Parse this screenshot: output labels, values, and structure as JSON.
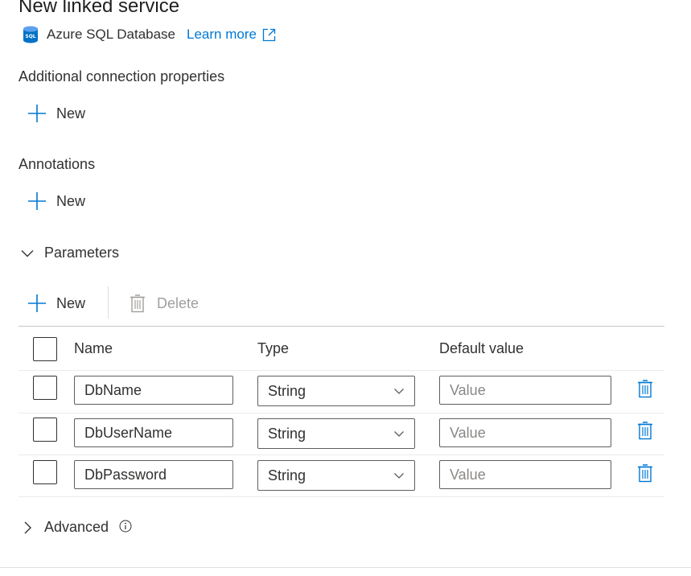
{
  "header": {
    "title": "New linked service",
    "service_name": "Azure SQL Database",
    "learn_more": "Learn more",
    "db_icon_text": "SQL"
  },
  "sections": {
    "connection_properties": {
      "label": "Additional connection properties",
      "new_label": "New"
    },
    "annotations": {
      "label": "Annotations",
      "new_label": "New"
    },
    "parameters": {
      "label": "Parameters",
      "expanded": true,
      "toolbar": {
        "new_label": "New",
        "delete_label": "Delete",
        "delete_enabled": false
      },
      "columns": [
        "Name",
        "Type",
        "Default value"
      ],
      "rows": [
        {
          "name": "DbName",
          "type": "String",
          "default_placeholder": "Value"
        },
        {
          "name": "DbUserName",
          "type": "String",
          "default_placeholder": "Value"
        },
        {
          "name": "DbPassword",
          "type": "String",
          "default_placeholder": "Value"
        }
      ]
    },
    "advanced": {
      "label": "Advanced",
      "expanded": false
    }
  },
  "colors": {
    "accent": "#0078d4",
    "text": "#323130",
    "disabled": "#a19f9d"
  },
  "icons": {
    "db": "azure-sql-database-icon",
    "external": "external-link-icon",
    "add": "add-icon",
    "delete": "trash-icon",
    "chevron_down": "chevron-down-icon",
    "chevron_right": "chevron-right-icon",
    "info": "info-icon"
  }
}
